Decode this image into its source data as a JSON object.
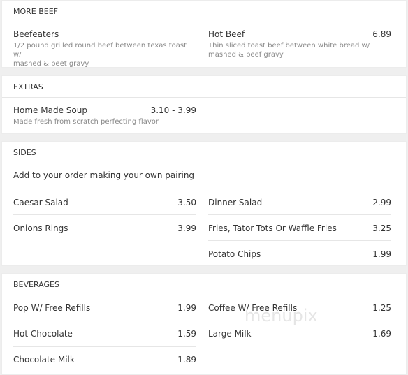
{
  "sections": {
    "more_beef": {
      "title": "MORE BEEF",
      "items": [
        {
          "name": "Beefeaters",
          "price": "",
          "desc_line1": "1/2 pound grilled round beef between texas toast w/",
          "desc_line2": "mashed & beet gravy."
        },
        {
          "name": "Hot Beef",
          "price": "6.89",
          "desc_line1": "Thin sliced toast beef between white bread w/",
          "desc_line2": "mashed & beef gravy"
        }
      ]
    },
    "extras": {
      "title": "EXTRAS",
      "items": [
        {
          "name": "Home Made Soup",
          "price": "3.10 - 3.99",
          "desc_line1": "Made fresh from scratch perfecting flavor"
        }
      ]
    },
    "sides": {
      "title": "SIDES",
      "description": "Add to your order making your own pairing",
      "items": [
        {
          "name": "Caesar Salad",
          "price": "3.50"
        },
        {
          "name": "Dinner Salad",
          "price": "2.99"
        },
        {
          "name": "Onions Rings",
          "price": "3.99"
        },
        {
          "name": "Fries, Tator Tots Or Waffle Fries",
          "price": "3.25"
        },
        {
          "name": "Potato Chips",
          "price": "1.99"
        }
      ]
    },
    "beverages": {
      "title": "BEVERAGES",
      "items": [
        {
          "name": "Pop W/ Free Refills",
          "price": "1.99"
        },
        {
          "name": "Coffee W/ Free Refills",
          "price": "1.25"
        },
        {
          "name": "Hot Chocolate",
          "price": "1.59"
        },
        {
          "name": "Large Milk",
          "price": "1.69"
        },
        {
          "name": "Chocolate Milk",
          "price": "1.89"
        }
      ]
    }
  },
  "watermark": "menupix"
}
